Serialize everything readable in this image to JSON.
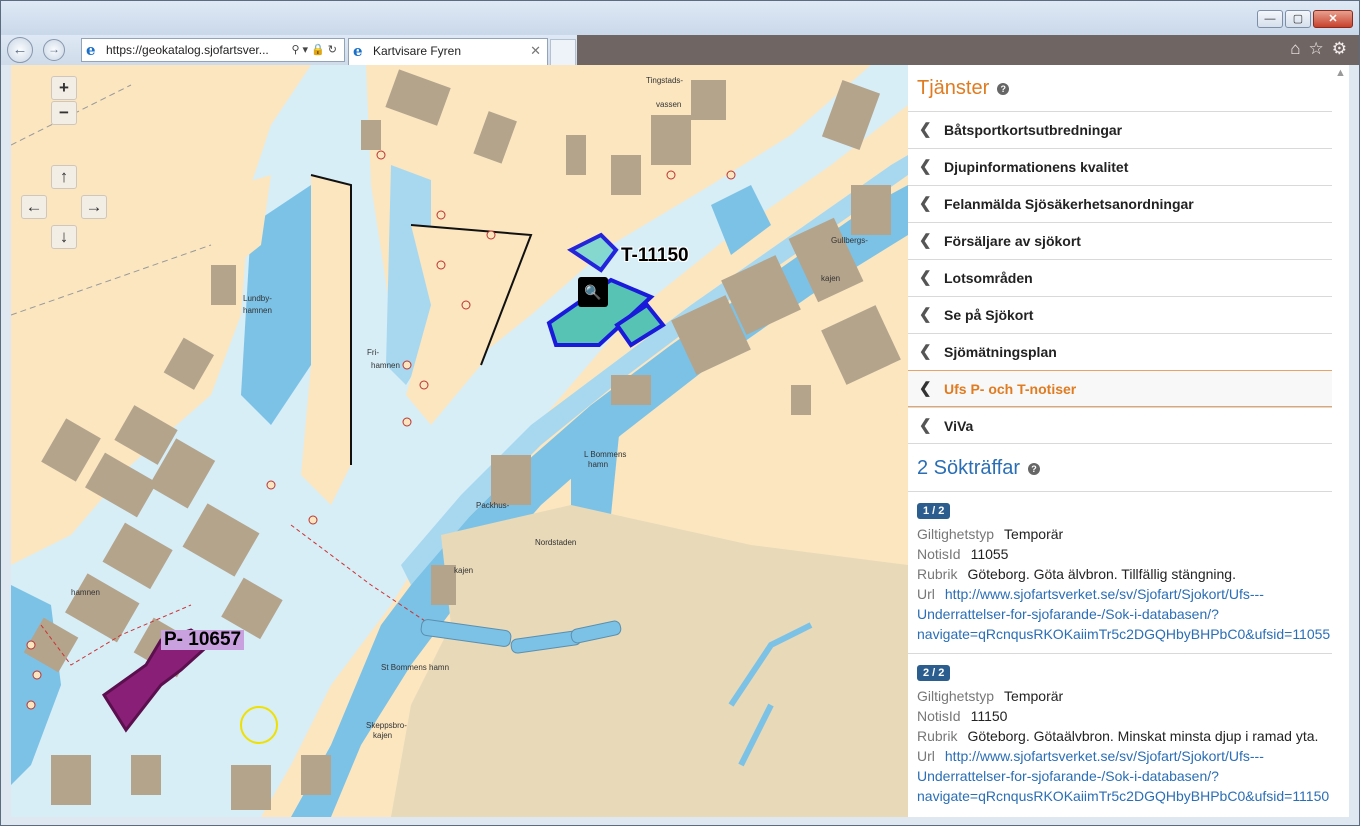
{
  "browser": {
    "address": "https://geokatalog.sjofartsver...",
    "tab_title": "Kartvisare Fyren",
    "window_buttons": [
      "—",
      "▢",
      "✕"
    ]
  },
  "map": {
    "zoom_in": "+",
    "zoom_out": "−",
    "pan_up": "↑",
    "pan_left": "←",
    "pan_right": "→",
    "pan_down": "↓",
    "label_t": "T-11150",
    "label_p": "P- 10657",
    "place_names": {
      "lundbyhamnen": "Lundby-\nhamnen",
      "frihamnen": "Fri-\nhamnen",
      "tingstadsvassen": "Tingstads-\nvassen",
      "gullbergskajen": "Gullbergs-\nkajen",
      "l_bommens_hamn": "L Bommens\nhamn",
      "packhuskajen": "Packhus-\nkajen",
      "nordstaden": "Nordstaden",
      "st_bommens_hamn": "St Bommens hamn",
      "skeppsbrokajen": "Skeppsbro-\nkajen",
      "mollhamnen": "hamnen"
    }
  },
  "panel": {
    "services_title": "Tjänster",
    "services": [
      {
        "label": "Båtsportkortsutbredningar",
        "active": false
      },
      {
        "label": "Djupinformationens kvalitet",
        "active": false
      },
      {
        "label": "Felanmälda Sjösäkerhetsanordningar",
        "active": false
      },
      {
        "label": "Försäljare av sjökort",
        "active": false
      },
      {
        "label": "Lotsområden",
        "active": false
      },
      {
        "label": "Se på Sjökort",
        "active": false
      },
      {
        "label": "Sjömätningsplan",
        "active": false
      },
      {
        "label": "Ufs P- och T-notiser",
        "active": true
      },
      {
        "label": "ViVa",
        "active": false
      }
    ],
    "results_title": "2 Sökträffar",
    "results": [
      {
        "badge": "1 / 2",
        "giltighetstyp_label": "Giltighetstyp",
        "giltighetstyp": "Temporär",
        "notisid_label": "NotisId",
        "notisid": "11055",
        "rubrik_label": "Rubrik",
        "rubrik": "Göteborg. Göta älvbron. Tillfällig stängning.",
        "url_label": "Url",
        "url_line1": "http://www.sjofartsverket.se/sv/Sjofart/Sjokort/Ufs---",
        "url_line2": "Underrattelser-for-sjofarande-/Sok-i-databasen/?",
        "url_line3": "navigate=qRcnqusRKOKaiimTr5c2DGQHbyBHPbC0&ufsid=11055"
      },
      {
        "badge": "2 / 2",
        "giltighetstyp_label": "Giltighetstyp",
        "giltighetstyp": "Temporär",
        "notisid_label": "NotisId",
        "notisid": "11150",
        "rubrik_label": "Rubrik",
        "rubrik": "Göteborg. Götaälvbron. Minskat minsta djup i ramad yta.",
        "url_label": "Url",
        "url_line1": "http://www.sjofartsverket.se/sv/Sjofart/Sjokort/Ufs---",
        "url_line2": "Underrattelser-for-sjofarande-/Sok-i-databasen/?",
        "url_line3": "navigate=qRcnqusRKOKaiimTr5c2DGQHbyBHPbC0&ufsid=11150"
      }
    ]
  }
}
